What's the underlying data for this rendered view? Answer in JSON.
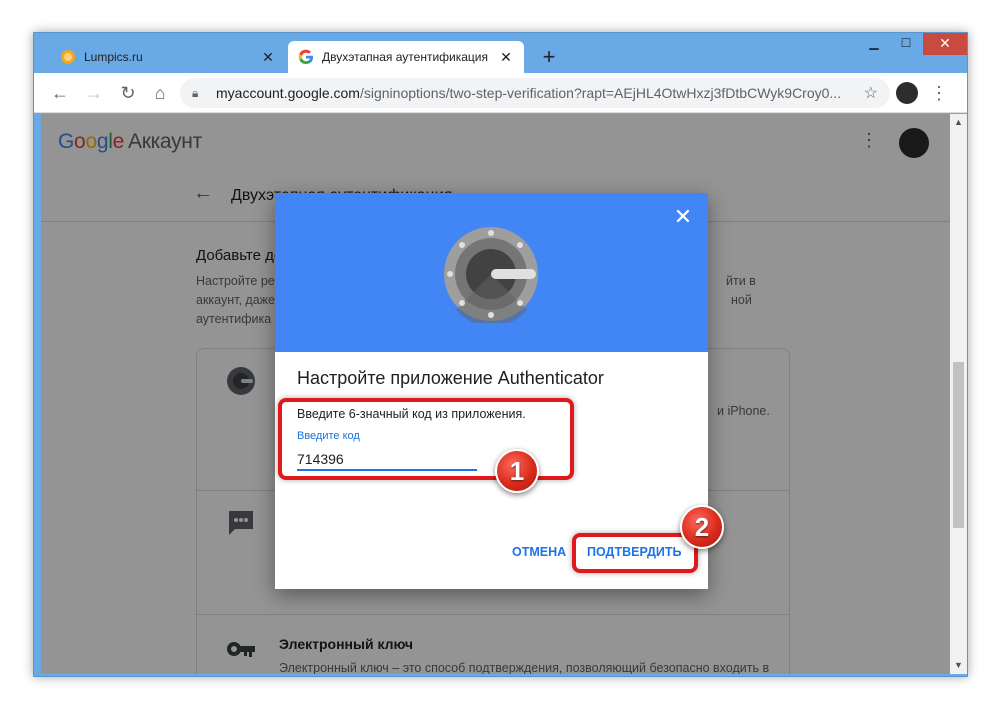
{
  "browser": {
    "tabs": [
      {
        "title": "Lumpics.ru",
        "active": false,
        "favicon": "orange-circle-icon"
      },
      {
        "title": "Двухэтапная аутентификация",
        "active": true,
        "favicon": "google-g-icon"
      }
    ],
    "address": {
      "host": "myaccount.google.com",
      "path": "/signinoptions/two-step-verification?rapt=AEjHL4OtwHxzj3fDtbCWyk9Croy0..."
    }
  },
  "header": {
    "logo_letters": [
      "G",
      "o",
      "o",
      "g",
      "l",
      "e"
    ],
    "account_label": "Аккаунт"
  },
  "subheader": {
    "title": "Двухэтапная аутентификация"
  },
  "section": {
    "title": "Добавьте до",
    "desc_line1": "Настройте ре",
    "desc_line1_right": "йти в",
    "desc_line2": "аккаунт, даже",
    "desc_line2_right": "ной",
    "desc_line3": "аутентифика"
  },
  "card": {
    "row1_text": "и iPhone.",
    "row3_title": "Электронный ключ",
    "row3_desc": "Электронный ключ – это способ подтверждения, позволяющий безопасно входить в"
  },
  "dialog": {
    "title": "Настройте приложение Authenticator",
    "instruction": "Введите 6-значный код из приложения.",
    "field_label": "Введите код",
    "field_value": "714396",
    "cancel_label": "ОТМЕНА",
    "confirm_label": "ПОДТВЕРДИТЬ"
  },
  "annotations": {
    "badge1": "1",
    "badge2": "2",
    "color": "#e0191c"
  },
  "colors": {
    "accent": "#1a73e8",
    "hero": "#4285f4",
    "chrome_frame": "#68a9e6"
  }
}
